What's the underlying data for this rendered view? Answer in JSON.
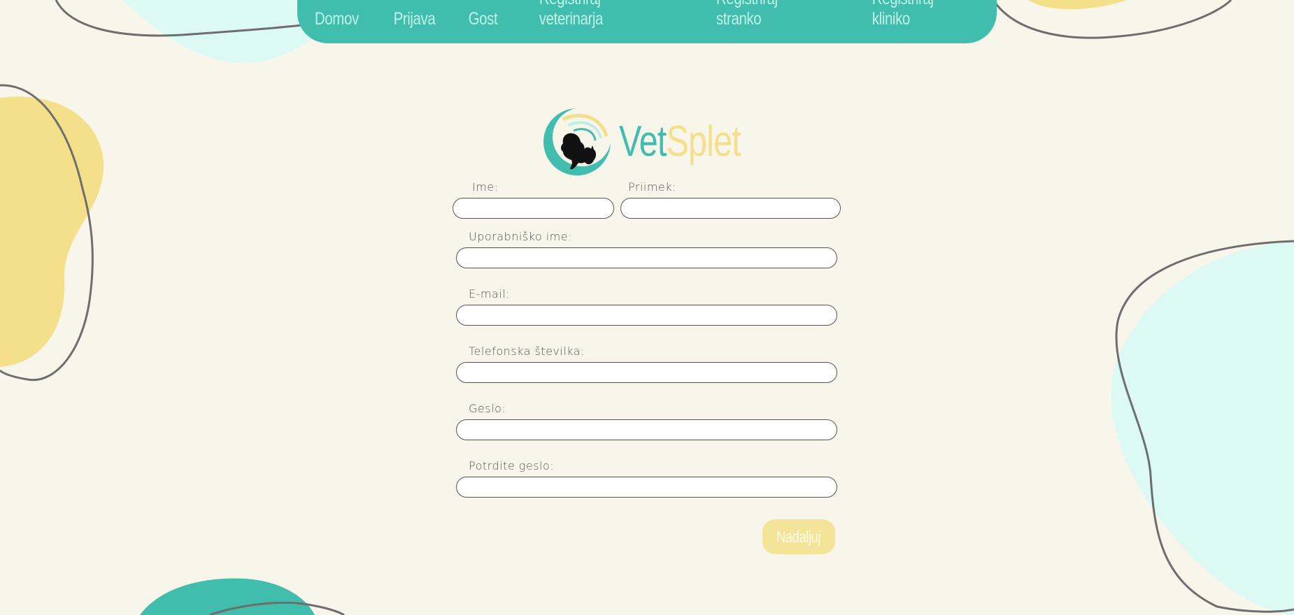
{
  "nav": {
    "items": [
      {
        "label": "Domov"
      },
      {
        "label": "Prijava"
      },
      {
        "label": "Gost"
      },
      {
        "label": "Registriraj veterinarja"
      },
      {
        "label": "Registriraj stranko"
      },
      {
        "label": "Registriraj kliniko"
      }
    ]
  },
  "logo": {
    "part1": "Vet",
    "part2": "Splet"
  },
  "form": {
    "first_name_label": "Ime:",
    "first_name_value": "",
    "last_name_label": "Priimek:",
    "last_name_value": "",
    "username_label": "Uporabniško ime:",
    "username_value": "",
    "email_label": "E-mail:",
    "email_value": "",
    "phone_label": "Telefonska številka:",
    "phone_value": "",
    "password_label": "Geslo:",
    "password_value": "",
    "confirm_password_label": "Potrdite geslo:",
    "confirm_password_value": "",
    "continue_label": "Nadaljuj"
  },
  "colors": {
    "background": "#f8f5eb",
    "teal": "#41bdad",
    "light_teal": "#dcf9f4",
    "yellow": "#f4e08a",
    "nav_text": "#bff3ea"
  }
}
